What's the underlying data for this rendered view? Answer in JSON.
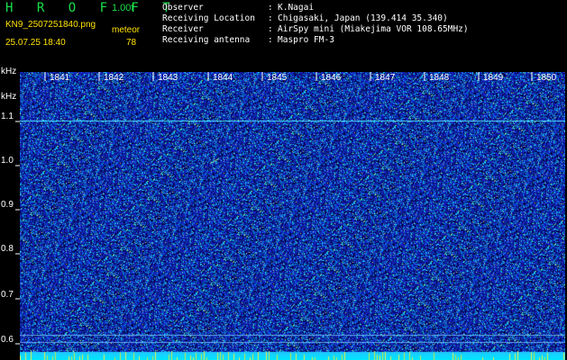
{
  "header": {
    "app_title": "H R O F F T",
    "version": "1.00f",
    "filename": "KN9_2507251840.png",
    "meteor_label": "meteor",
    "datetime": "25.07.25 18:40",
    "meteor_count": "78"
  },
  "metadata": [
    {
      "label": "Observer",
      "value": "K.Nagai"
    },
    {
      "label": "Receiving Location",
      "value": "Chigasaki, Japan (139.414 35.340)"
    },
    {
      "label": "Receiver",
      "value": "AirSpy mini (Miakejima VOR 108.65MHz)"
    },
    {
      "label": "Receiving antenna",
      "value": "Maspro FM-3"
    }
  ],
  "separator": ":",
  "plot": {
    "y_unit_top": "kHz",
    "y_unit_bottom": "kHz",
    "y_ticks": [
      "1.1",
      "1.0",
      "0.9",
      "0.8",
      "0.7",
      "0.6"
    ],
    "x_ticks": [
      "1841",
      "1842",
      "1843",
      "1844",
      "1845",
      "1846",
      "1847",
      "1848",
      "1849",
      "1850"
    ]
  },
  "colors": {
    "background": "#000000",
    "spectrum_blue": "#1a2ab8",
    "title_green": "#19e04a",
    "info_yellow": "#ffe000",
    "text_white": "#ffffff",
    "carrier_cyan": "#00e8ff",
    "bottom_band": "#00d8ff"
  }
}
